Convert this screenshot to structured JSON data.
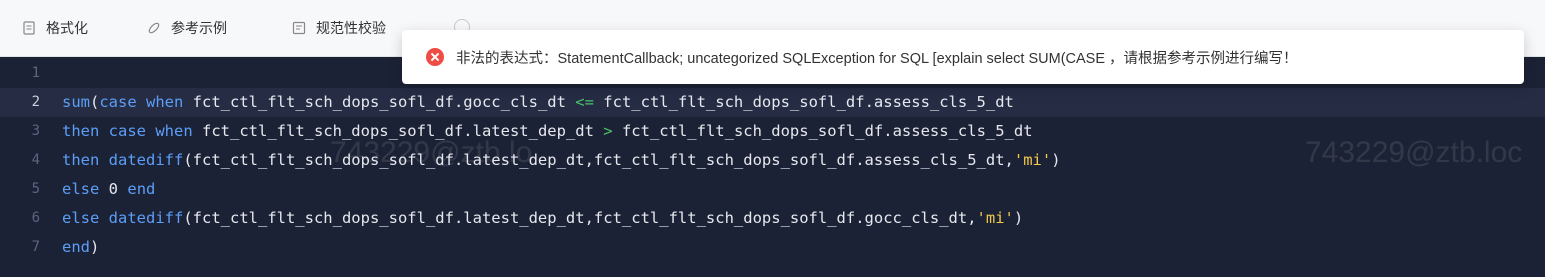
{
  "toolbar": {
    "format_label": "格式化",
    "example_label": "参考示例",
    "validate_label": "规范性校验"
  },
  "editor": {
    "lines": [
      {
        "num": "1"
      },
      {
        "num": "2"
      },
      {
        "num": "3"
      },
      {
        "num": "4"
      },
      {
        "num": "5"
      },
      {
        "num": "6"
      },
      {
        "num": "7"
      }
    ],
    "tokens": {
      "l2": [
        "sum",
        "(",
        "case",
        " ",
        "when",
        " fct_ctl_flt_sch_dops_sofl_df.gocc_cls_dt ",
        "<=",
        " fct_ctl_flt_sch_dops_sofl_df.assess_cls_5_dt"
      ],
      "l3": [
        "then",
        " ",
        "case",
        " ",
        "when",
        " fct_ctl_flt_sch_dops_sofl_df.latest_dep_dt ",
        ">",
        " fct_ctl_flt_sch_dops_sofl_df.assess_cls_5_dt"
      ],
      "l4": [
        "then",
        " ",
        "datediff",
        "(fct_ctl_flt_sch_dops_sofl_df.latest_dep_dt,fct_ctl_flt_sch_dops_sofl_df.assess_cls_5_dt,",
        "'mi'",
        ")"
      ],
      "l5": [
        "else",
        " ",
        "0",
        " ",
        "end"
      ],
      "l6": [
        "else",
        " ",
        "datediff",
        "(fct_ctl_flt_sch_dops_sofl_df.latest_dep_dt,fct_ctl_flt_sch_dops_sofl_df.gocc_cls_dt,",
        "'mi'",
        ")"
      ],
      "l7": [
        "end",
        ")"
      ]
    },
    "watermark_1": "743229@ztb.lo",
    "watermark_2": "743229@ztb.loc"
  },
  "toast": {
    "message": "非法的表达式：StatementCallback; uncategorized SQLException for SQL [explain select SUM(CASE ，请根据参考示例进行编写！"
  }
}
